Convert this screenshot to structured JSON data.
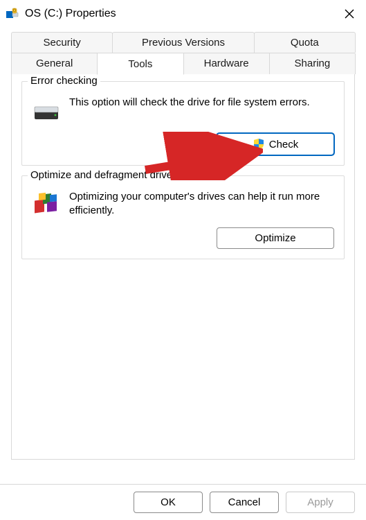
{
  "window": {
    "title": "OS (C:) Properties"
  },
  "tabs": {
    "row1": [
      "Security",
      "Previous Versions",
      "Quota"
    ],
    "row2": [
      "General",
      "Tools",
      "Hardware",
      "Sharing"
    ],
    "active": "Tools"
  },
  "error_checking": {
    "legend": "Error checking",
    "description": "This option will check the drive for file system errors.",
    "button": "Check"
  },
  "optimize": {
    "legend": "Optimize and defragment drive",
    "description": "Optimizing your computer's drives can help it run more efficiently.",
    "button": "Optimize"
  },
  "footer": {
    "ok": "OK",
    "cancel": "Cancel",
    "apply": "Apply"
  }
}
